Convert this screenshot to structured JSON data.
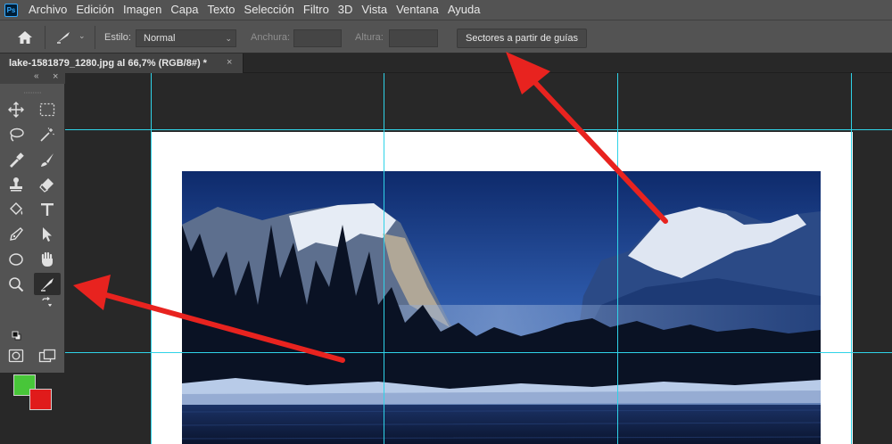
{
  "app": {
    "logo_text": "Ps"
  },
  "menu": [
    "Archivo",
    "Edición",
    "Imagen",
    "Capa",
    "Texto",
    "Selección",
    "Filtro",
    "3D",
    "Vista",
    "Ventana",
    "Ayuda"
  ],
  "options": {
    "style_label": "Estilo:",
    "style_value": "Normal",
    "width_label": "Anchura:",
    "width_value": "",
    "height_label": "Altura:",
    "height_value": "",
    "slices_button": "Sectores a partir de guías"
  },
  "document": {
    "tab_title": "lake-1581879_1280.jpg al 66,7% (RGB/8#) *",
    "close_glyph": "×"
  },
  "panel": {
    "collapse_glyph": "«",
    "close_glyph": "×"
  },
  "colors": {
    "foreground": "#48c639",
    "background": "#e01b1b",
    "guide": "#2fd3e8",
    "annotation_arrow": "#e8231f"
  },
  "tools": [
    {
      "icon": "move-tool-icon"
    },
    {
      "icon": "marquee-tool-icon"
    },
    {
      "icon": "lasso-tool-icon"
    },
    {
      "icon": "magic-wand-tool-icon"
    },
    {
      "icon": "eyedropper-tool-icon"
    },
    {
      "icon": "brush-tool-icon"
    },
    {
      "icon": "stamp-tool-icon"
    },
    {
      "icon": "eraser-tool-icon"
    },
    {
      "icon": "paint-bucket-tool-icon"
    },
    {
      "icon": "type-tool-icon"
    },
    {
      "icon": "pen-tool-icon"
    },
    {
      "icon": "path-selection-tool-icon"
    },
    {
      "icon": "ellipse-tool-icon"
    },
    {
      "icon": "hand-tool-icon"
    },
    {
      "icon": "zoom-tool-icon"
    },
    {
      "icon": "slice-tool-icon",
      "active": true
    },
    {
      "icon": "quick-mask-icon"
    },
    {
      "icon": "screen-mode-icon"
    }
  ]
}
